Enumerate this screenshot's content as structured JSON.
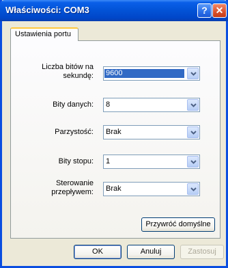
{
  "window": {
    "title": "Właściwości: COM3",
    "help_glyph": "?",
    "close_glyph": "✕"
  },
  "tabs": [
    {
      "label": "Ustawienia portu",
      "active": true
    }
  ],
  "settings": {
    "baud": {
      "label": "Liczba bitów na sekundę:",
      "value": "9600"
    },
    "data_bits": {
      "label": "Bity danych:",
      "value": "8"
    },
    "parity": {
      "label": "Parzystość:",
      "value": "Brak"
    },
    "stop_bits": {
      "label": "Bity stopu:",
      "value": "1"
    },
    "flow": {
      "label": "Sterowanie przepływem:",
      "value": "Brak"
    }
  },
  "restore_defaults_label": "Przywróć domyślne",
  "buttons": {
    "ok": "OK",
    "cancel": "Anuluj",
    "apply": "Zastosuj"
  },
  "colors": {
    "titlebar": "#0054e3",
    "selection": "#316ac5",
    "face": "#ece9d8"
  }
}
